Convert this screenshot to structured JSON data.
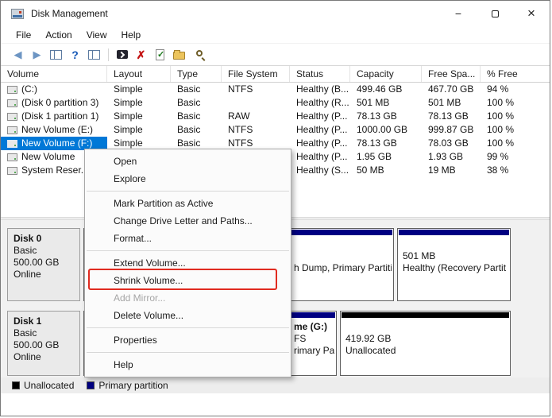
{
  "window": {
    "title": "Disk Management",
    "controls": {
      "minimize_glyph": "−",
      "close_glyph": "×"
    }
  },
  "menu_bar": {
    "items": [
      "File",
      "Action",
      "View",
      "Help"
    ]
  },
  "toolbar": {
    "glyphs": {
      "back": "◀",
      "forward": "▶",
      "help": "?",
      "delete": "✗",
      "check": "✓"
    }
  },
  "table": {
    "columns": [
      "Volume",
      "Layout",
      "Type",
      "File System",
      "Status",
      "Capacity",
      "Free Spa...",
      "% Free"
    ],
    "rows": [
      {
        "volume": "(C:)",
        "layout": "Simple",
        "type": "Basic",
        "fs": "NTFS",
        "status": "Healthy (B...",
        "capacity": "499.46 GB",
        "free": "467.70 GB",
        "pct": "94 %"
      },
      {
        "volume": "(Disk 0 partition 3)",
        "layout": "Simple",
        "type": "Basic",
        "fs": "",
        "status": "Healthy (R...",
        "capacity": "501 MB",
        "free": "501 MB",
        "pct": "100 %"
      },
      {
        "volume": "(Disk 1 partition 1)",
        "layout": "Simple",
        "type": "Basic",
        "fs": "RAW",
        "status": "Healthy (P...",
        "capacity": "78.13 GB",
        "free": "78.13 GB",
        "pct": "100 %"
      },
      {
        "volume": "New Volume (E:)",
        "layout": "Simple",
        "type": "Basic",
        "fs": "NTFS",
        "status": "Healthy (P...",
        "capacity": "1000.00 GB",
        "free": "999.87 GB",
        "pct": "100 %"
      },
      {
        "volume": "New Volume (F:)",
        "layout": "Simple",
        "type": "Basic",
        "fs": "NTFS",
        "status": "Healthy (P...",
        "capacity": "78.13 GB",
        "free": "78.03 GB",
        "pct": "100 %",
        "selected": true
      },
      {
        "volume": "New Volume",
        "layout": "",
        "type": "",
        "fs": "",
        "status": "Healthy (P...",
        "capacity": "1.95 GB",
        "free": "1.93 GB",
        "pct": "99 %"
      },
      {
        "volume": "System Reser...",
        "layout": "",
        "type": "",
        "fs": "",
        "status": "Healthy (S...",
        "capacity": "50 MB",
        "free": "19 MB",
        "pct": "38 %"
      }
    ]
  },
  "context_menu": {
    "items": [
      {
        "type": "item",
        "label": "Open"
      },
      {
        "type": "item",
        "label": "Explore"
      },
      {
        "type": "separator"
      },
      {
        "type": "item",
        "label": "Mark Partition as Active"
      },
      {
        "type": "item",
        "label": "Change Drive Letter and Paths..."
      },
      {
        "type": "item",
        "label": "Format..."
      },
      {
        "type": "separator"
      },
      {
        "type": "item",
        "label": "Extend Volume..."
      },
      {
        "type": "item",
        "label": "Shrink Volume...",
        "highlighted": true
      },
      {
        "type": "item",
        "label": "Add Mirror...",
        "disabled": true
      },
      {
        "type": "item",
        "label": "Delete Volume..."
      },
      {
        "type": "separator"
      },
      {
        "type": "item",
        "label": "Properties"
      },
      {
        "type": "separator"
      },
      {
        "type": "item",
        "label": "Help"
      }
    ]
  },
  "disks": [
    {
      "name": "Disk 0",
      "type": "Basic",
      "size": "500.00 GB",
      "status": "Online",
      "partitions": [
        {
          "kind": "primary",
          "line3": "h Dump, Primary Partiti"
        },
        {
          "kind": "primary",
          "line2": "501 MB",
          "line3": "Healthy (Recovery Partit"
        }
      ]
    },
    {
      "name": "Disk 1",
      "type": "Basic",
      "size": "500.00 GB",
      "status": "Online",
      "partitions": [
        {
          "kind": "primary",
          "line1": "me  (G:)",
          "line2": "FS",
          "line3": "rimary Par"
        },
        {
          "kind": "unallocated",
          "line2": "419.92 GB",
          "line3": "Unallocated"
        }
      ]
    }
  ],
  "legend": {
    "items": [
      {
        "label": "Unallocated",
        "color": "#000000"
      },
      {
        "label": "Primary partition",
        "color": "#000082"
      }
    ]
  },
  "colors": {
    "selection": "#0078d7",
    "primary_partition": "#000082",
    "unallocated": "#000000",
    "annotation": "#e02b20"
  }
}
